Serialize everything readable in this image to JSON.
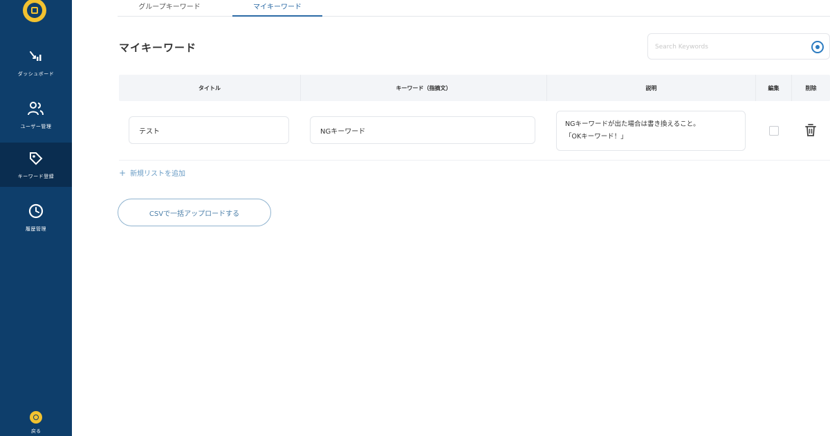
{
  "sidebar": {
    "items": [
      {
        "label": "ダッシュボード",
        "icon": "dashboard-icon"
      },
      {
        "label": "ユーザー管理",
        "icon": "users-icon"
      },
      {
        "label": "キーワード登録",
        "icon": "tag-icon",
        "active": true
      },
      {
        "label": "履歴管理",
        "icon": "history-icon"
      }
    ],
    "logout_label": "戻る"
  },
  "tabs": [
    {
      "label": "グループキーワード",
      "active": false
    },
    {
      "label": "マイキーワード",
      "active": true
    }
  ],
  "page_title": "マイキーワード",
  "search": {
    "placeholder": "Search Keywords"
  },
  "table": {
    "headers": [
      "タイトル",
      "キーワード（指摘文）",
      "説明",
      "編集",
      "削除"
    ],
    "rows": [
      {
        "title": "テスト",
        "keyword": "NGキーワード",
        "description_line1": "NGキーワードが出た場合は書き換えること。",
        "description_line2": "「OKキーワード！」",
        "edit_checked": false
      }
    ]
  },
  "add_list_label": "新規リストを追加",
  "csv_button_label": "CSVで一括アップロードする",
  "colors": {
    "sidebar": "#0e3e6b",
    "accent": "#2b6aa5",
    "logo": "#f2c230"
  }
}
